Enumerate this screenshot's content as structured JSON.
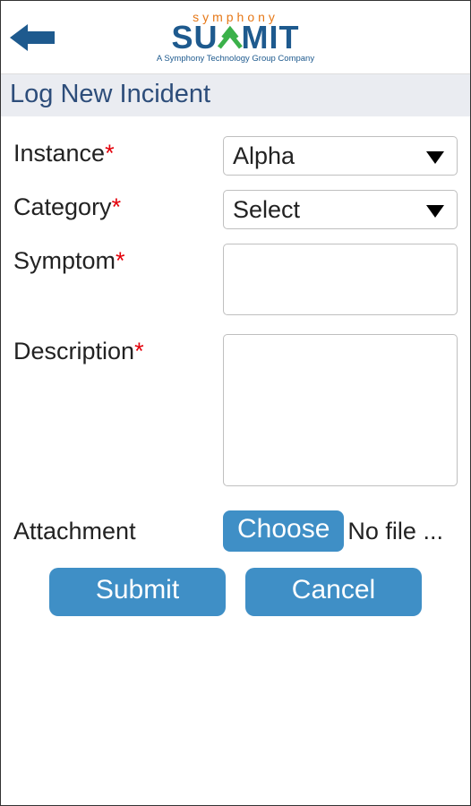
{
  "header": {
    "logo_top": "symphony",
    "logo_main_left": "SU",
    "logo_main_right": "MIT",
    "logo_tagline": "A Symphony Technology Group Company"
  },
  "page_title": "Log New Incident",
  "form": {
    "instance": {
      "label": "Instance",
      "value": "Alpha"
    },
    "category": {
      "label": "Category",
      "value": "Select"
    },
    "symptom": {
      "label": "Symptom",
      "value": ""
    },
    "description": {
      "label": "Description",
      "value": ""
    },
    "attachment": {
      "label": "Attachment",
      "choose_label": "Choose",
      "file_status": "No file ..."
    }
  },
  "buttons": {
    "submit": "Submit",
    "cancel": "Cancel"
  }
}
